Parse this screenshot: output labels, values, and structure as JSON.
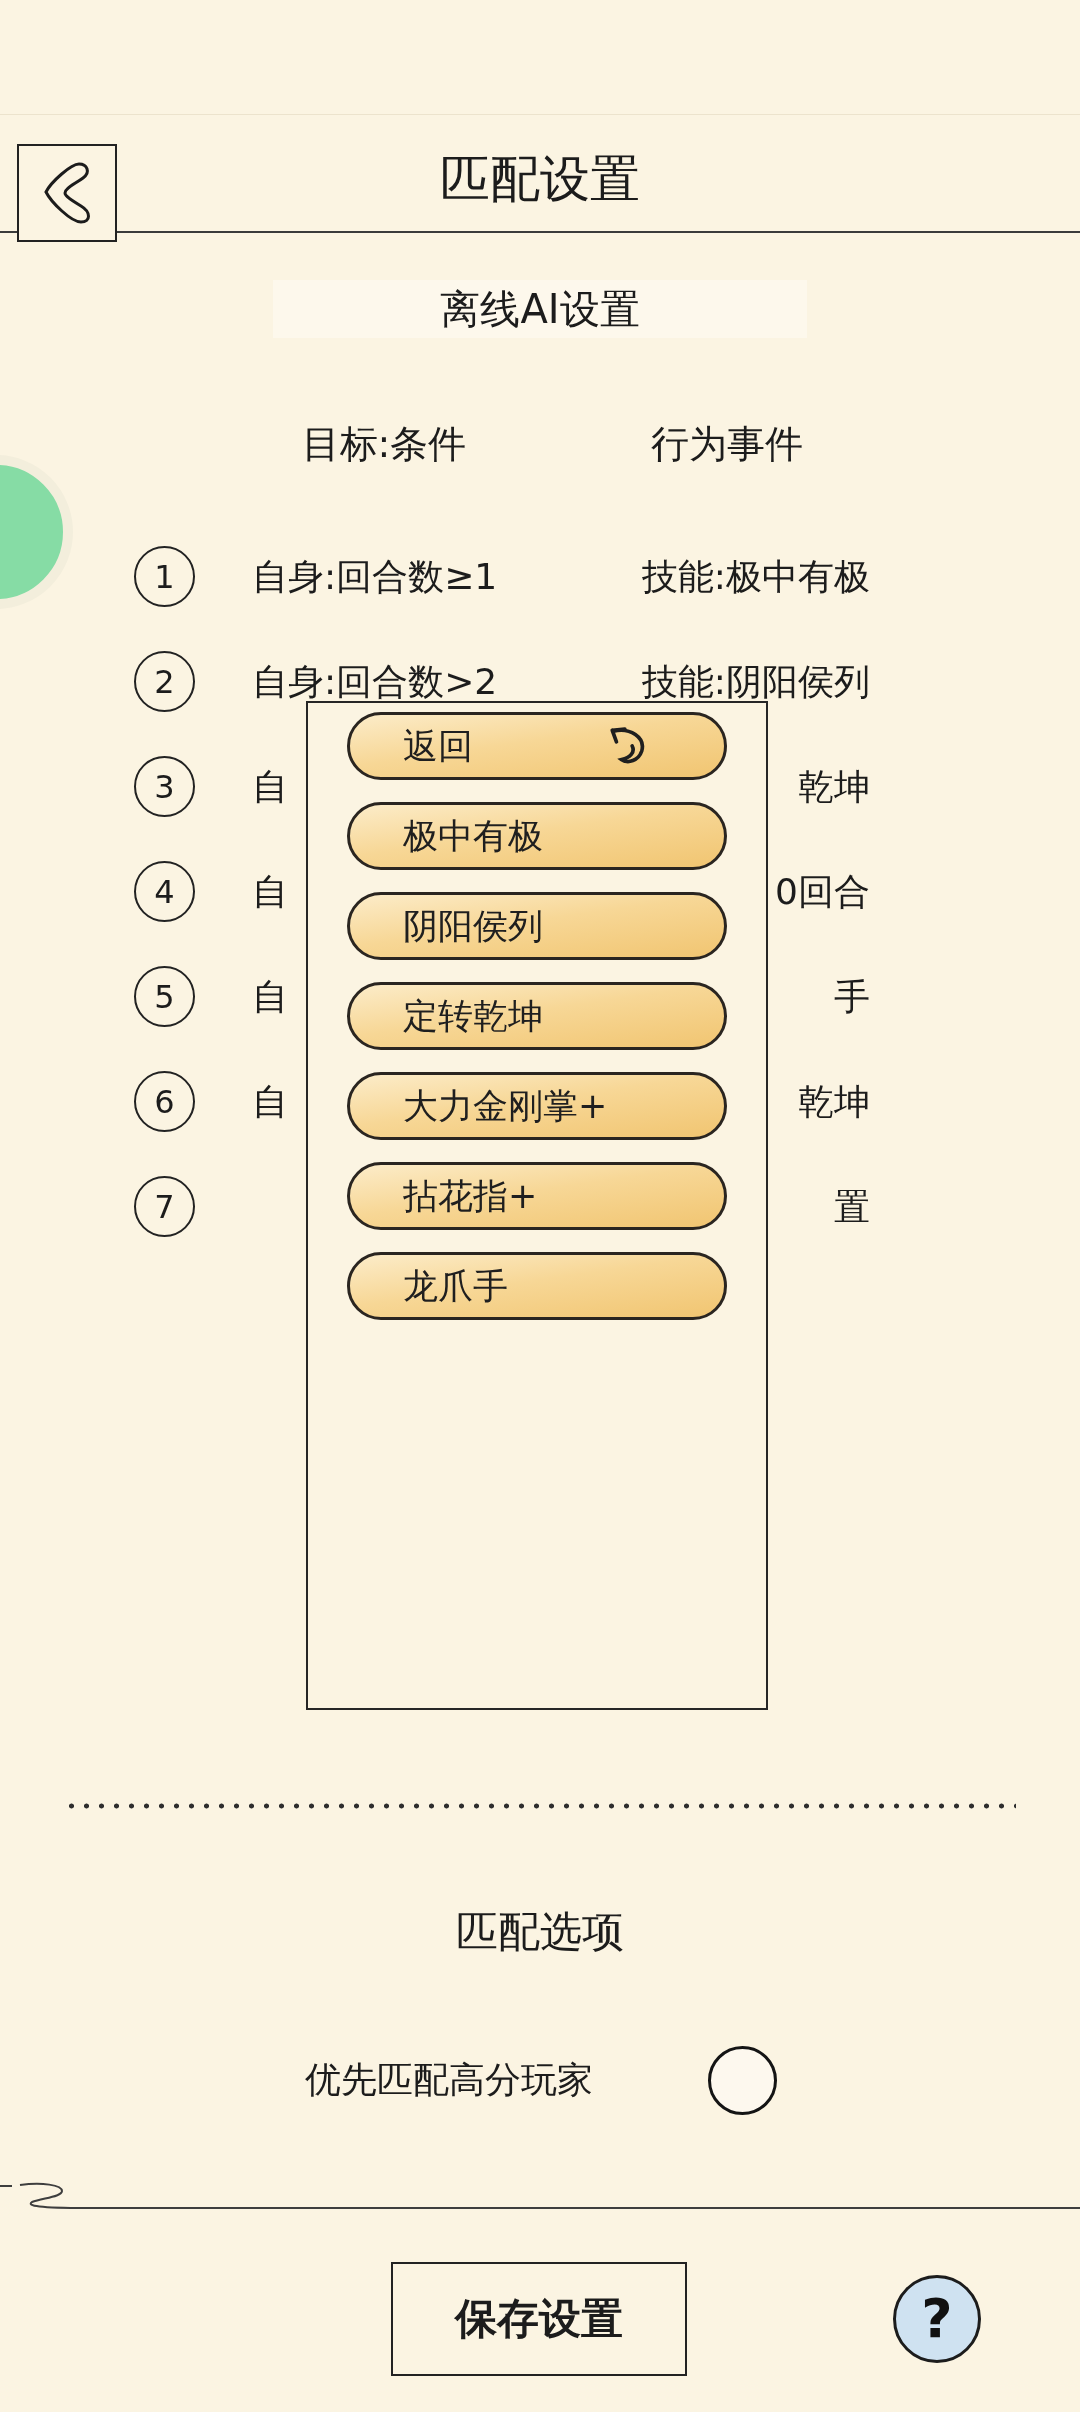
{
  "header": {
    "title": "匹配设置"
  },
  "ai_section": {
    "title": "离线AI设置",
    "columns": [
      "目标:条件",
      "行为事件"
    ],
    "rules": [
      {
        "number": "1",
        "condition": "自身:回合数≥1",
        "action": "技能:极中有极"
      },
      {
        "number": "2",
        "condition": "自身:回合数>2",
        "action": "技能:阴阳侯列"
      },
      {
        "number": "3",
        "condition": "自",
        "action": "乾坤"
      },
      {
        "number": "4",
        "condition": "自",
        "action": "0回合"
      },
      {
        "number": "5",
        "condition": "自",
        "action": "手"
      },
      {
        "number": "6",
        "condition": "自",
        "action": "乾坤"
      },
      {
        "number": "7",
        "action": "置"
      }
    ]
  },
  "skill_menu": {
    "items": [
      {
        "label": "返回",
        "kind": "back"
      },
      {
        "label": "极中有极",
        "kind": "skill"
      },
      {
        "label": "阴阳侯列",
        "kind": "skill"
      },
      {
        "label": "定转乾坤",
        "kind": "skill"
      },
      {
        "label": "大力金刚掌+",
        "kind": "skill"
      },
      {
        "label": "拈花指+",
        "kind": "skill"
      },
      {
        "label": "龙爪手",
        "kind": "skill"
      }
    ]
  },
  "match_options": {
    "title": "匹配选项",
    "options": [
      {
        "label": "优先匹配高分玩家",
        "on": false
      }
    ]
  },
  "footer": {
    "save_button": "保存设置",
    "help_button": "?"
  }
}
